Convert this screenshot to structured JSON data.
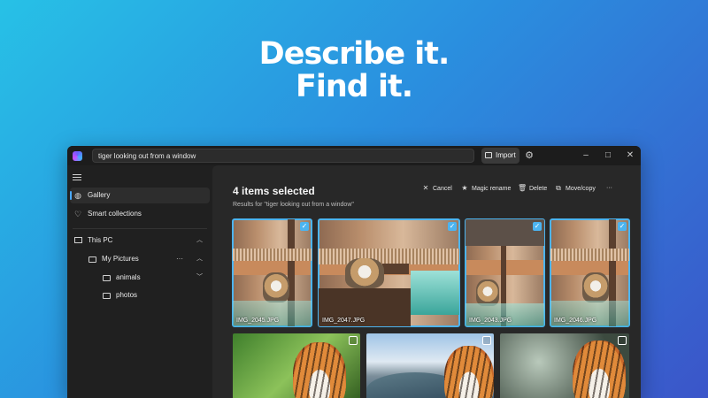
{
  "hero": {
    "line1": "Describe it.",
    "line2": "Find it."
  },
  "window": {
    "search_value": "tiger looking out from a window",
    "import_label": "Import",
    "controls": {
      "minimize": "–",
      "maximize": "□",
      "close": "✕"
    }
  },
  "sidebar": {
    "items": [
      {
        "label": "Gallery"
      },
      {
        "label": "Smart collections"
      },
      {
        "label": "This PC"
      },
      {
        "label": "My Pictures"
      },
      {
        "label": "animals"
      },
      {
        "label": "photos"
      }
    ]
  },
  "main": {
    "title": "4 items selected",
    "subtitle": "Results for \"tiger looking out from a window\"",
    "toolbar": {
      "cancel": "Cancel",
      "magic_rename": "Magic rename",
      "delete": "Delete",
      "move_copy": "Move/copy",
      "more": "···"
    },
    "photos": [
      {
        "name": "IMG_2045.JPG",
        "selected": true
      },
      {
        "name": "IMG_2047.JPG",
        "selected": true
      },
      {
        "name": "IMG_2043.JPG",
        "selected": true
      },
      {
        "name": "IMG_2046.JPG",
        "selected": true
      },
      {
        "name": "",
        "selected": false
      },
      {
        "name": "",
        "selected": false
      },
      {
        "name": "",
        "selected": false
      }
    ]
  },
  "colors": {
    "accent": "#4cb4f0",
    "window_bg": "#202020",
    "content_bg": "#282828"
  },
  "icons": [
    "app-logo-icon",
    "import-icon",
    "settings-icon",
    "menu-icon",
    "gallery-icon",
    "heart-icon",
    "pc-icon",
    "folder-icon",
    "close-icon",
    "star-icon",
    "trash-icon",
    "move-icon",
    "checkmark-icon"
  ]
}
